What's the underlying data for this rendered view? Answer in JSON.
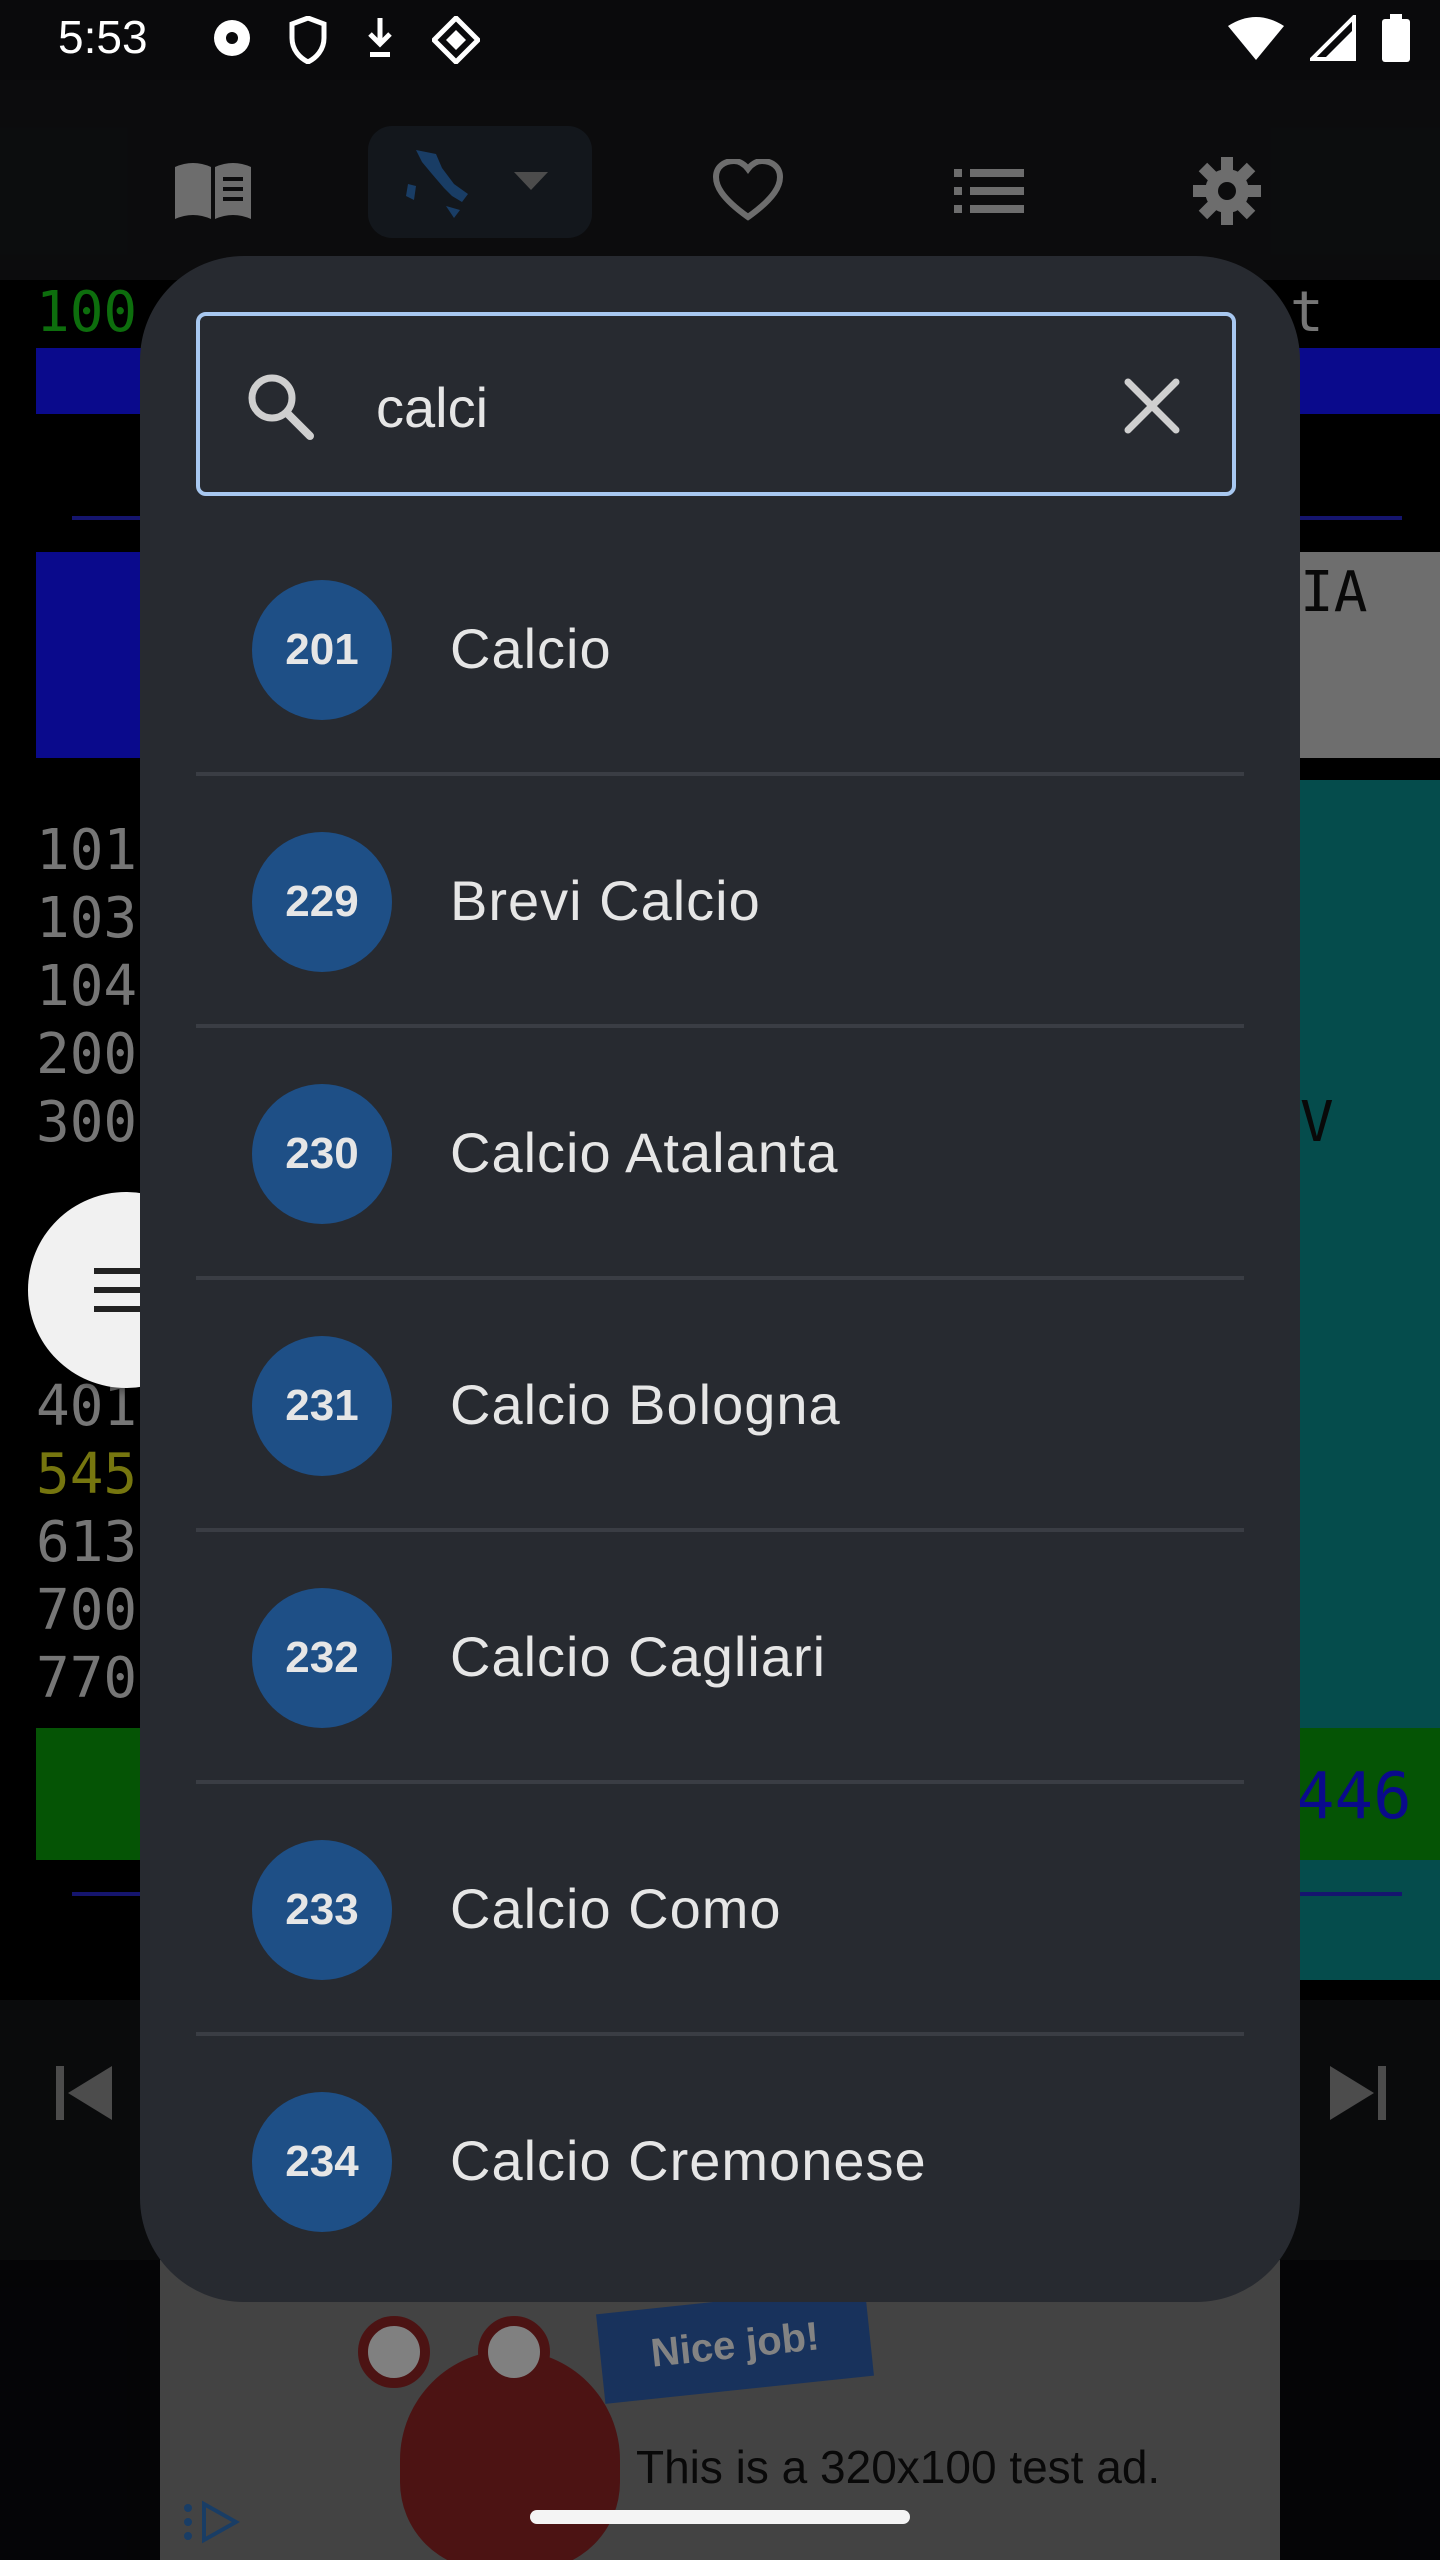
{
  "status": {
    "time": "5:53"
  },
  "search": {
    "value": "calci",
    "placeholder": "Search"
  },
  "results": [
    {
      "number": "201",
      "name": "Calcio"
    },
    {
      "number": "229",
      "name": "Brevi Calcio"
    },
    {
      "number": "230",
      "name": "Calcio Atalanta"
    },
    {
      "number": "231",
      "name": "Calcio Bologna"
    },
    {
      "number": "232",
      "name": "Calcio Cagliari"
    },
    {
      "number": "233",
      "name": "Calcio Como"
    },
    {
      "number": "234",
      "name": "Calcio Cremonese"
    }
  ],
  "background_teletext": {
    "lines": [
      "100",
      "101",
      "103",
      "104",
      "200",
      "300",
      "401",
      "545",
      "613",
      "700",
      "770"
    ],
    "right_text_top": "t",
    "right_text_banner": "IA",
    "right_text_mid": "V",
    "right_number": "446"
  },
  "ad": {
    "text": "This is a 320x100 test ad.",
    "tag": "Nice job!"
  },
  "colors": {
    "accent": "#a8c8f0",
    "badge": "#1e4f86",
    "dialog": "#272a30"
  }
}
